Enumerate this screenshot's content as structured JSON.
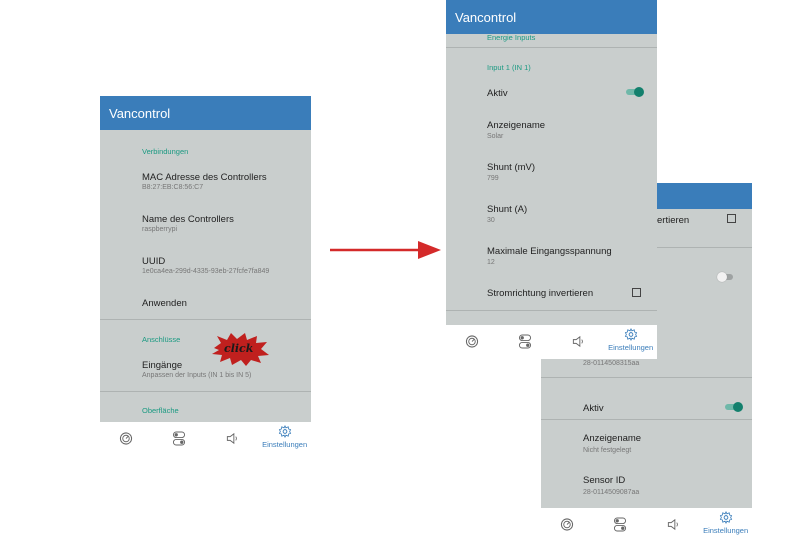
{
  "colors": {
    "appbar": "#3a7dba",
    "accent": "#1b9a82",
    "screen_bg": "#c9cecd",
    "arrow": "#d42a2a",
    "nav_active": "#3a7dba"
  },
  "screen1": {
    "title": "Vancontrol",
    "section_connections": "Verbindungen",
    "mac_label": "MAC Adresse des Controllers",
    "mac_value": "B8:27:EB:C8:56:C7",
    "name_label": "Name des Controllers",
    "name_value": "raspberrypi",
    "uuid_label": "UUID",
    "uuid_value": "1e0ca4ea-299d-4335-93eb-27fcfe7fa849",
    "apply_label": "Anwenden",
    "section_ports": "Anschlüsse",
    "inputs_label": "Eingänge",
    "inputs_sub": "Anpassen der Inputs (IN 1 bis IN 5)",
    "section_surface": "Oberfläche",
    "click_badge": "click"
  },
  "screen2": {
    "title": "Vancontrol",
    "section_energy": "Energie Inputs",
    "section_input1": "Input 1 (IN 1)",
    "active_label": "Aktiv",
    "active_on": true,
    "display_name_label": "Anzeigename",
    "display_name_value": "Solar",
    "shunt_mv_label": "Shunt (mV)",
    "shunt_mv_value": "799",
    "shunt_a_label": "Shunt (A)",
    "shunt_a_value": "30",
    "max_voltage_label": "Maximale Eingangsspannung",
    "max_voltage_value": "12",
    "invert_label": "Stromrichtung invertieren",
    "invert_checked": false
  },
  "screen3": {
    "partial_label": "ertieren",
    "partial_id": "28-0114508315aa",
    "active_label": "Aktiv",
    "display_name_label": "Anzeigename",
    "display_name_value": "Nicht festgelegt",
    "sensor_id_label": "Sensor ID",
    "sensor_id_value": "28-0114509087aa"
  },
  "nav": {
    "items": [
      {
        "icon": "gauge-icon"
      },
      {
        "icon": "switches-icon"
      },
      {
        "icon": "speaker-icon"
      },
      {
        "icon": "gear-icon",
        "label": "Einstellungen"
      }
    ]
  }
}
